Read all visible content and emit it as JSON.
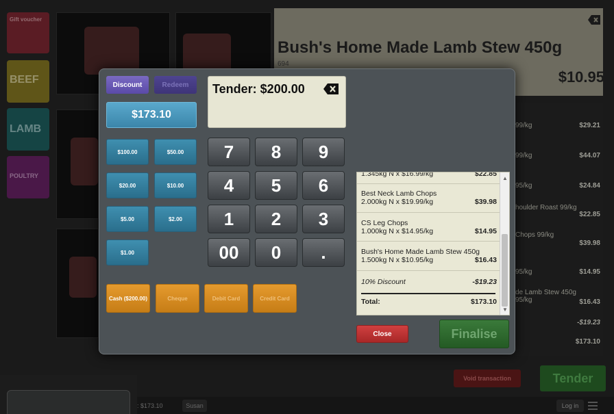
{
  "categories": [
    "Gift voucher",
    "BEEF",
    "LAMB",
    "POULTRY"
  ],
  "product": {
    "title": "Bush's Home Made Lamb Stew 450g",
    "code": "694",
    "price": "$10.95"
  },
  "background_basket": [
    {
      "desc": "99/kg",
      "amount": "$29.21"
    },
    {
      "desc": "99/kg",
      "amount": "$44.07"
    },
    {
      "desc": "95/kg",
      "amount": "$24.84"
    },
    {
      "desc": "houlder Roast 99/kg",
      "amount": "$22.85"
    },
    {
      "desc": "Chops 99/kg",
      "amount": "$39.98"
    },
    {
      "desc": "95/kg",
      "amount": "$14.95"
    },
    {
      "desc": "de Lamb Stew 450g 95/kg",
      "amount": "$16.43"
    },
    {
      "desc": "",
      "amount": "-$19.23"
    },
    {
      "desc": "",
      "amount": "$173.10"
    }
  ],
  "background_buttons": {
    "void": "Void transaction",
    "tender": "Tender",
    "login": "Log in",
    "footer_total": ": $173.10",
    "footer_user": "Susan"
  },
  "modal": {
    "discount_label": "Discount",
    "redeem_label": "Redeem",
    "exact_amount": "$173.10",
    "tender_text": "Tender: $200.00",
    "quick_amounts": [
      "$100.00",
      "$50.00",
      "$20.00",
      "$10.00",
      "$5.00",
      "$2.00",
      "$1.00"
    ],
    "keypad": [
      "7",
      "8",
      "9",
      "4",
      "5",
      "6",
      "1",
      "2",
      "3",
      "00",
      "0",
      "."
    ],
    "payment_methods": [
      "Cash ($200.00)",
      "Cheque",
      "Debit Card",
      "Credit Card"
    ],
    "close_label": "Close",
    "finalise_label": "Finalise"
  },
  "receipt": {
    "partial_top": {
      "line": "1.345kg N x $16.99/kg",
      "amount": "$22.85"
    },
    "items": [
      {
        "name": "Best Neck Lamb Chops",
        "detail": "2.000kg N x $19.99/kg",
        "amount": "$39.98"
      },
      {
        "name": "CS Leg Chops",
        "detail": "1.000kg N x $14.95/kg",
        "amount": "$14.95"
      },
      {
        "name": "Bush's Home Made Lamb Stew 450g",
        "detail": "1.500kg N x $10.95/kg",
        "amount": "$16.43"
      }
    ],
    "discount": {
      "label": "10% Discount",
      "amount": "-$19.23"
    },
    "total": {
      "label": "Total:",
      "amount": "$173.10"
    }
  },
  "colors": {
    "accent_teal": "#3b86aa",
    "accent_orange": "#d88a22",
    "accent_purple": "#6a5ab5",
    "close_red": "#b83030",
    "finalise_green": "#2f6a2f"
  }
}
